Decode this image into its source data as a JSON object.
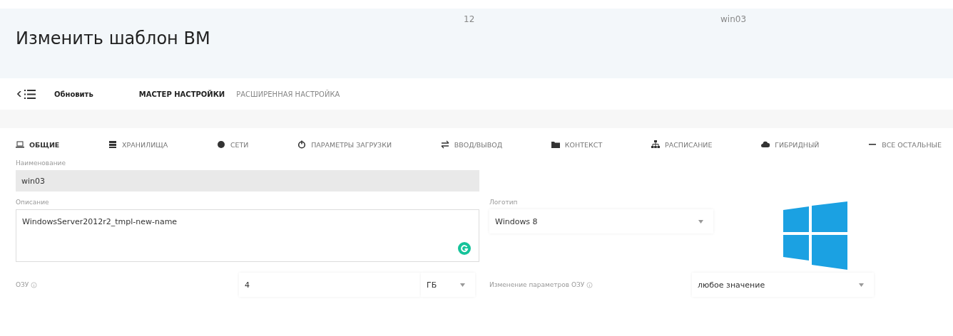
{
  "header": {
    "title": "Изменить шаблон ВМ",
    "id": "12",
    "name": "win03"
  },
  "toolbar": {
    "refresh": "Обновить",
    "modes": [
      {
        "label": "МАСТЕР НАСТРОЙКИ",
        "selected": true
      },
      {
        "label": "РАСШИРЕННАЯ НАСТРОЙКА",
        "selected": false
      }
    ]
  },
  "tabs": [
    {
      "label": "ОБЩИЕ",
      "selected": true
    },
    {
      "label": "ХРАНИЛИЩА",
      "selected": false
    },
    {
      "label": "СЕТИ",
      "selected": false
    },
    {
      "label": "ПАРАМЕТРЫ ЗАГРУЗКИ",
      "selected": false
    },
    {
      "label": "ВВОД/ВЫВОД",
      "selected": false
    },
    {
      "label": "КОНТЕКСТ",
      "selected": false
    },
    {
      "label": "РАСПИСАНИЕ",
      "selected": false
    },
    {
      "label": "ГИБРИДНЫЙ",
      "selected": false
    },
    {
      "label": "ВСЕ ОСТАЛЬНЫЕ",
      "selected": false
    }
  ],
  "form": {
    "name": {
      "label": "Наименование",
      "value": "win03",
      "disabled": true
    },
    "description": {
      "label": "Описание",
      "value": "WindowsServer2012r2_tmpl-new-name"
    },
    "logo": {
      "label": "Логотип",
      "value": "Windows 8"
    },
    "ram": {
      "label": "ОЗУ",
      "value": "4",
      "unit": "ГБ"
    },
    "ram_change": {
      "label": "Изменение параметров ОЗУ",
      "value": "любое значение"
    }
  }
}
